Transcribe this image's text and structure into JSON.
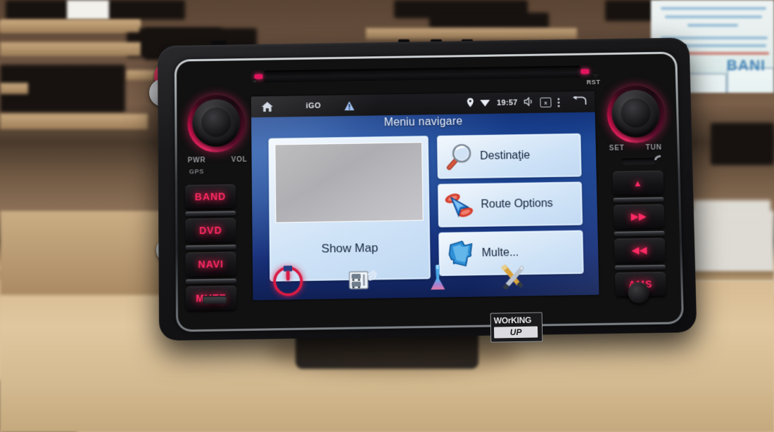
{
  "scene": {
    "description": "Car head unit on a workbench showing iGO navigation menu",
    "poster_text": "BANI"
  },
  "device": {
    "brand_sticker_line1": "WOrKING",
    "brand_sticker_line2": "UP",
    "reset_label": "RST",
    "left_knob": {
      "top_left_label": "PWR",
      "top_right_label": "VOL",
      "sub_label": "GPS"
    },
    "right_knob": {
      "top_left_label": "SET",
      "top_right_label": "TUN",
      "sd_icon": "sd-card-icon"
    },
    "left_buttons": [
      {
        "label": "BAND",
        "name": "band-button"
      },
      {
        "label": "DVD",
        "name": "dvd-button"
      },
      {
        "label": "NAVI",
        "name": "navi-button"
      },
      {
        "label": "MUTE",
        "name": "mute-button"
      }
    ],
    "right_buttons": [
      {
        "label": "▲",
        "name": "eject-button"
      },
      {
        "label": "▶▶",
        "name": "next-track-button"
      },
      {
        "label": "◀◀",
        "name": "previous-track-button"
      },
      {
        "label": "AMS",
        "name": "ams-button"
      }
    ],
    "accent_color": "#ff2a63",
    "body_color": "#141416"
  },
  "screen": {
    "status_bar": {
      "home_icon": "home-icon",
      "app_label": "iGO",
      "warning_icon": "warning-triangle-icon",
      "gps_icon": "location-pin-icon",
      "wifi_icon": "wifi-icon",
      "time": "19:57",
      "volume_icon": "volume-mute-icon",
      "screenshot_icon": "screenshot-box-icon",
      "overflow_icon": "overflow-menu-icon",
      "back_icon": "back-arrow-icon"
    },
    "app": {
      "title": "Meniu navigare",
      "show_map": {
        "label": "Show Map",
        "name": "show-map-panel"
      },
      "menu_items": [
        {
          "label": "Destinaţie",
          "icon": "magnifier-icon",
          "name": "destination-button"
        },
        {
          "label": "Route Options",
          "icon": "route-cursor-icon",
          "name": "route-options-button"
        },
        {
          "label": "Multe...",
          "icon": "puzzle-piece-icon",
          "name": "more-button"
        }
      ],
      "toolbar": [
        {
          "icon": "power-icon",
          "name": "exit-power-button"
        },
        {
          "icon": "traffic-tmc-icon",
          "name": "traffic-button"
        },
        {
          "icon": "beacon-cone-icon",
          "name": "beacon-button"
        },
        {
          "icon": "tools-icon",
          "name": "settings-tools-button"
        }
      ],
      "accent_color": "#1c4796",
      "panel_color": "#dceaf8"
    }
  }
}
